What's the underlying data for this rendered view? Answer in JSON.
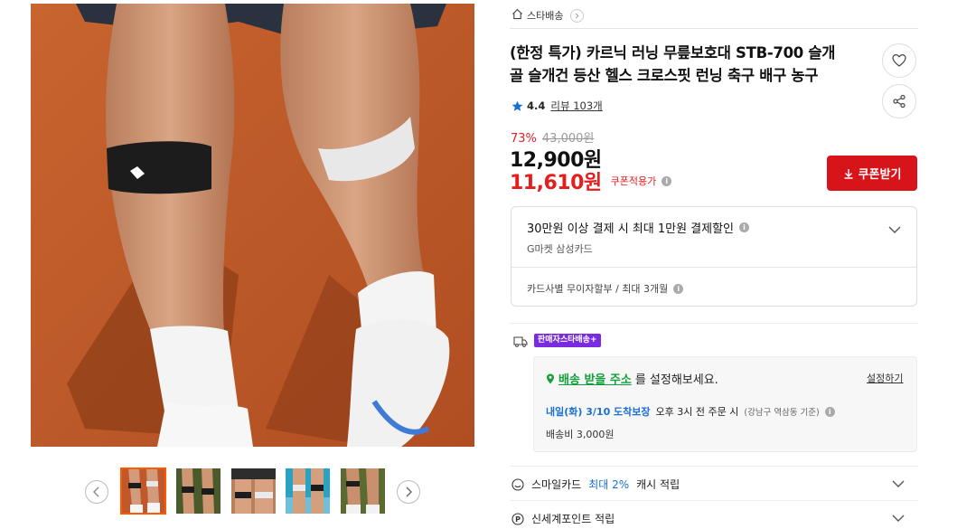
{
  "gallery": {
    "thumb_count": 5,
    "selected_thumb": 1,
    "thumbnails": [
      "thumb-knee-band-1",
      "thumb-knee-band-2",
      "thumb-knee-band-3",
      "thumb-knee-band-4",
      "thumb-knee-band-5"
    ]
  },
  "breadcrumb": {
    "label": "스타배송"
  },
  "product": {
    "title_line1": "(한정 특가) 카르닉 러닝 무릎보호대 STB-700 슬개",
    "title_line2": "골 슬개건 등산 헬스 크로스핏 런닝 축구 배구 농구",
    "rating": "4.4",
    "review_label": "리뷰 103개",
    "discount_rate": "73%",
    "original_price": "43,000원",
    "sale_price": "12,900원",
    "coupon_price": "11,610원",
    "coupon_applied_label": "쿠폰적용가",
    "coupon_button_label": "쿠폰받기"
  },
  "card_benefit": {
    "title": "30만원 이상 결제 시 최대 1만원 결제할인",
    "card_name": "G마켓 삼성카드",
    "installment": "카드사별 무이자할부 / 최대 3개월"
  },
  "delivery": {
    "badge": "판매자스타배송+",
    "address_link": "배송 받을 주소",
    "address_suffix": "를 설정해보세요.",
    "setting_link": "설정하기",
    "arrival_date": "내일(화) 3/10 도착보장",
    "arrival_condition": "오후 3시 전 주문 시",
    "arrival_location": "(강남구 역삼동 기준)",
    "shipping_fee": "배송비 3,000원"
  },
  "benefits": {
    "smile_prefix": "스마일카드",
    "smile_highlight": "최대 2%",
    "smile_suffix": "캐시 적립",
    "point_label": "신세계포인트 적립"
  },
  "colors": {
    "accent_red": "#d8141b",
    "price_red": "#e51d1d",
    "link_green": "#12a03c",
    "date_blue": "#1a6fd1",
    "badge_purple": "#7a2ae0",
    "star_blue": "#1a6fd1"
  }
}
